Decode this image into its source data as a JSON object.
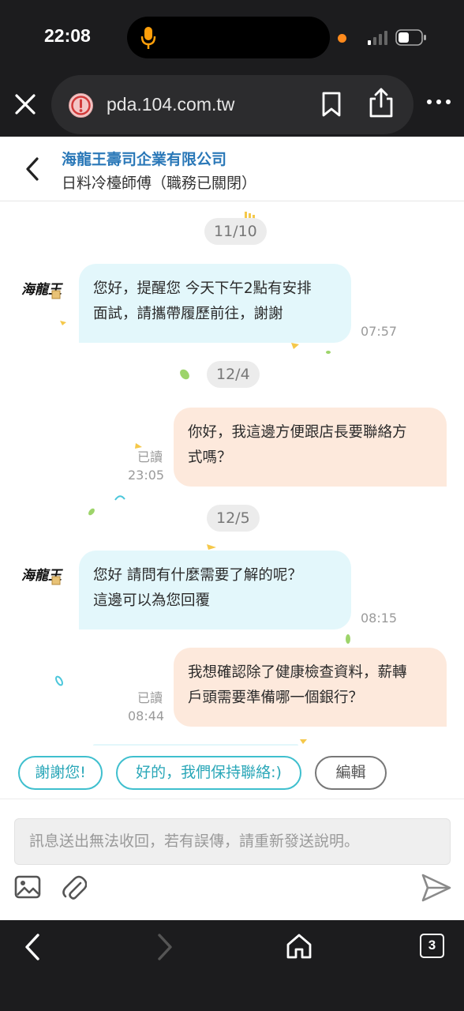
{
  "status_bar": {
    "time": "22:08"
  },
  "browser": {
    "url": "pda.104.com.tw",
    "tab_count": "3"
  },
  "header": {
    "company": "海龍王壽司企業有限公司",
    "job_title": "日料冷檯師傅（職務已關閉）"
  },
  "chat": {
    "avatar_text": "海龍王",
    "messages": [
      {
        "date": "11/10",
        "direction": "incoming",
        "lines": [
          "您好，提醒您 今天下午2點有安排",
          "面試，請攜帶履歷前往，謝謝"
        ],
        "time": "07:57"
      },
      {
        "date": "12/4",
        "direction": "outgoing",
        "lines": [
          "你好，我這邊方便跟店長要聯絡方",
          "式嗎？"
        ],
        "time": "23:05",
        "read": "已讀"
      },
      {
        "date": "12/5",
        "direction": "incoming",
        "lines": [
          "您好 請問有什麼需要了解的呢？",
          "這邊可以為您回覆"
        ],
        "time": "08:15"
      },
      {
        "direction": "outgoing",
        "lines": [
          "我想確認除了健康檢查資料，薪轉",
          "戶頭需要準備哪一個銀行？"
        ],
        "time": "08:44",
        "read": "已讀"
      }
    ]
  },
  "quick_replies": [
    "謝謝您!",
    "好的，我們保持聯絡:)",
    "編輯"
  ],
  "composer": {
    "placeholder": "訊息送出無法收回，若有誤傳，請重新發送說明。"
  },
  "colors": {
    "company_blue": "#2a78b8",
    "incoming_bubble": "#e3f7fb",
    "outgoing_bubble": "#fde9dc",
    "chip_teal": "#3fbfce"
  }
}
